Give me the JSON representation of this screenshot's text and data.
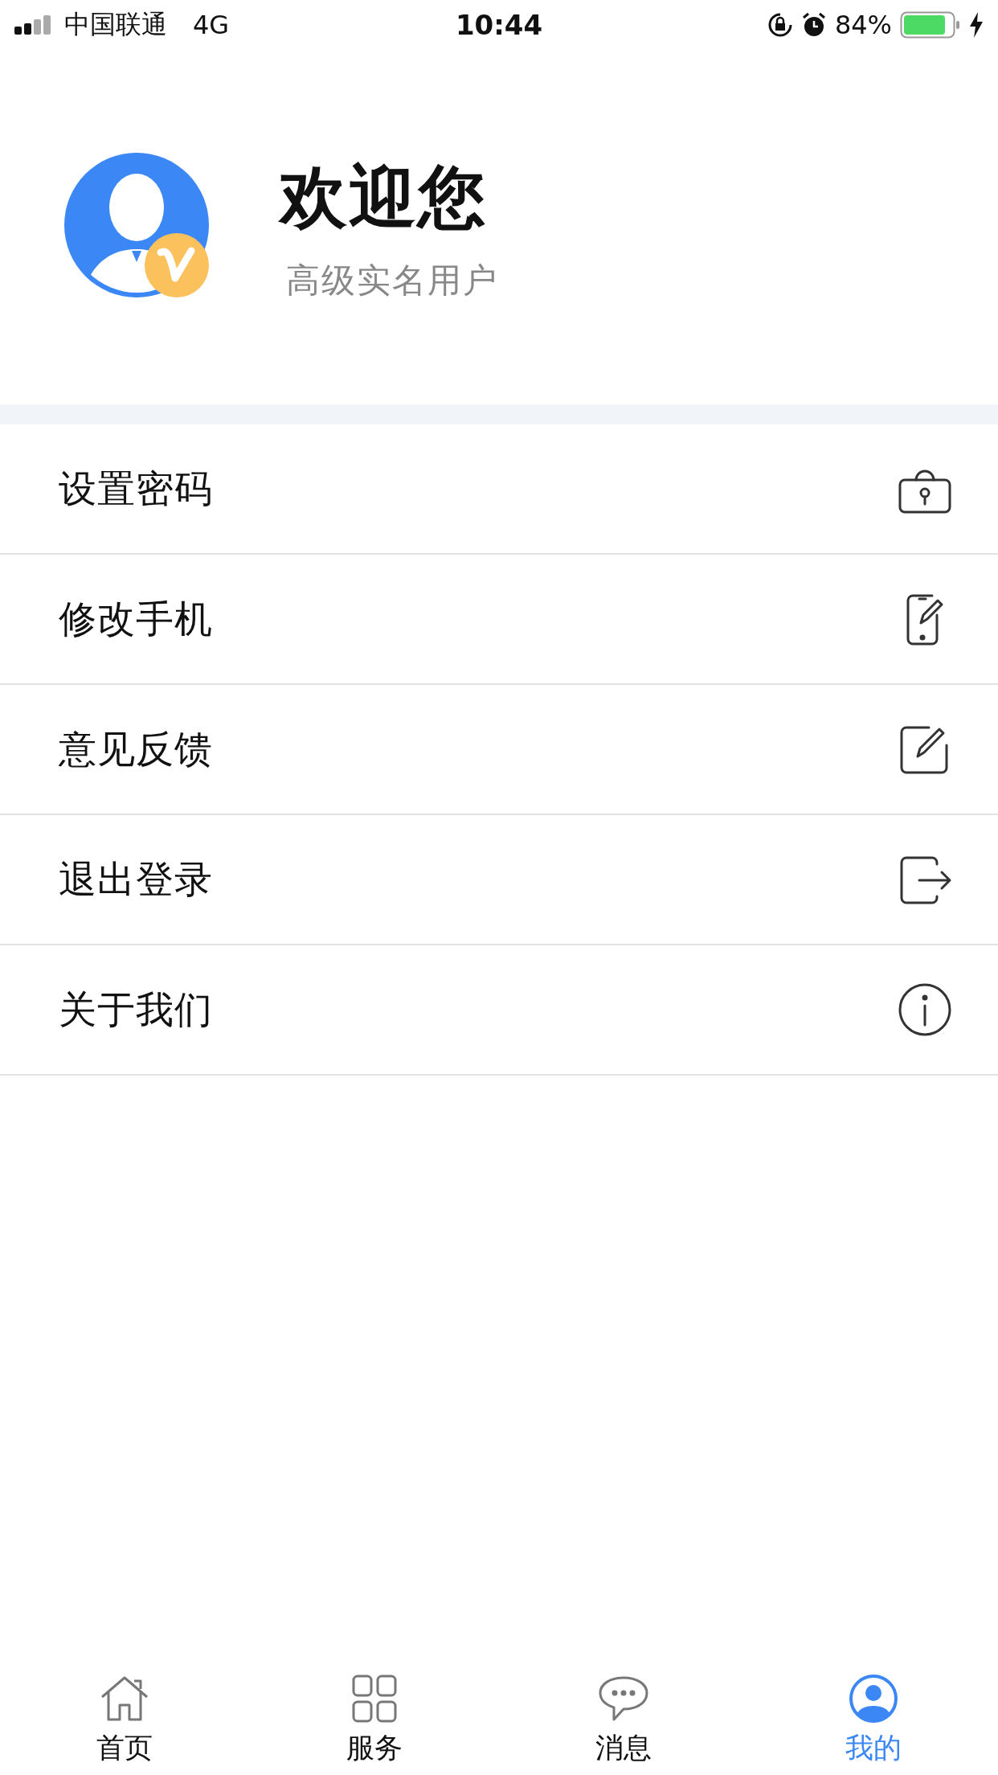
{
  "status_bar": {
    "carrier": "中国联通",
    "network": "4G",
    "time": "10:44",
    "battery": "84%"
  },
  "profile": {
    "title": "欢迎您",
    "subtitle": "高级实名用户",
    "verified": true
  },
  "menu": [
    {
      "label": "设置密码",
      "kind": "lock"
    },
    {
      "label": "修改手机",
      "kind": "phone"
    },
    {
      "label": "意见反馈",
      "kind": "edit"
    },
    {
      "label": "退出登录",
      "kind": "logout"
    },
    {
      "label": "关于我们",
      "kind": "info"
    }
  ],
  "tabs": [
    {
      "label": "首页",
      "kind": "home",
      "selected": false
    },
    {
      "label": "服务",
      "kind": "grid",
      "selected": false
    },
    {
      "label": "消息",
      "kind": "chat",
      "selected": false
    },
    {
      "label": "我的",
      "kind": "user",
      "selected": true
    }
  ]
}
